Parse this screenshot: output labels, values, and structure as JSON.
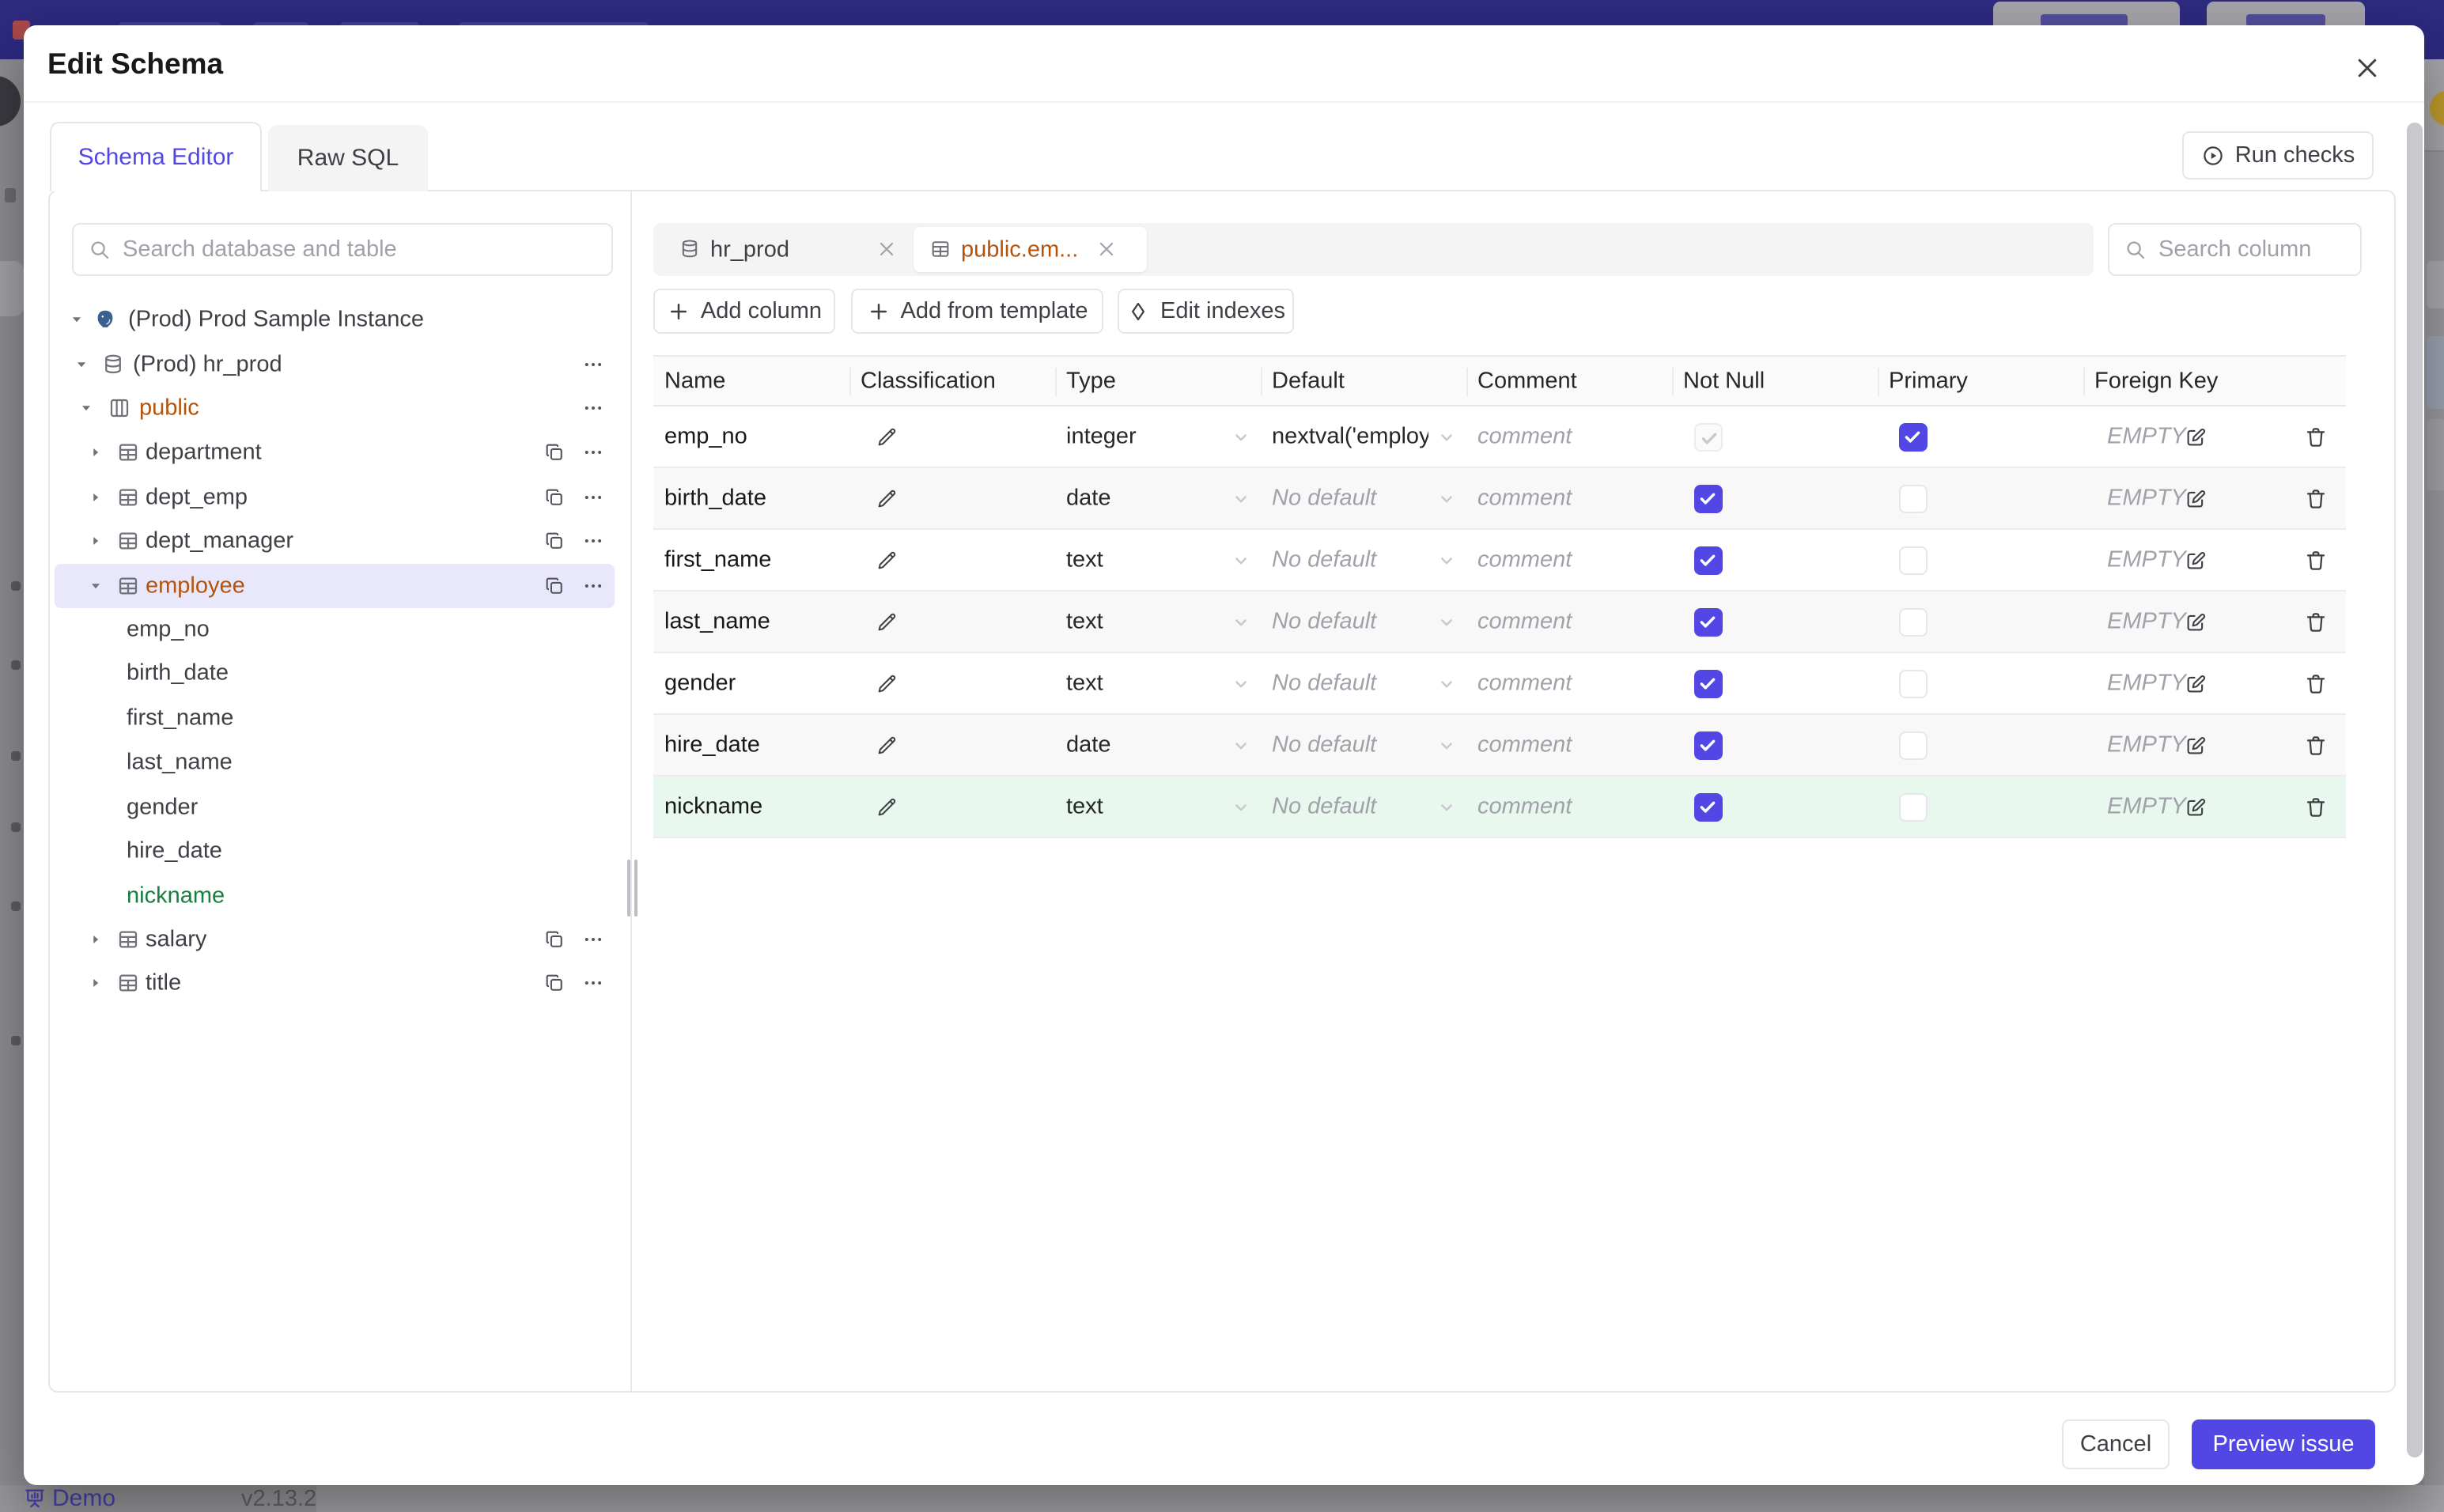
{
  "backdrop": {
    "demo_label": "Demo",
    "version_label": "v2.13.2"
  },
  "modal": {
    "title": "Edit Schema",
    "tabs": [
      {
        "label": "Schema Editor",
        "active": true
      },
      {
        "label": "Raw SQL",
        "active": false
      }
    ],
    "run_checks_label": "Run checks",
    "footer": {
      "cancel_label": "Cancel",
      "preview_label": "Preview issue"
    }
  },
  "sidebar": {
    "search_placeholder": "Search database and table",
    "tree": [
      {
        "level": 0,
        "icon": "postgres-icon",
        "caret": "down",
        "label": "(Prod) Prod Sample Instance",
        "color": null,
        "selected": false,
        "actions": []
      },
      {
        "level": 1,
        "icon": "database-icon",
        "caret": "down",
        "label": "(Prod) hr_prod",
        "color": null,
        "selected": false,
        "actions": [
          "more"
        ]
      },
      {
        "level": 2,
        "icon": "schema-icon",
        "caret": "down",
        "label": "public",
        "color": "amber",
        "selected": false,
        "actions": [
          "more"
        ]
      },
      {
        "level": 3,
        "icon": "table-icon",
        "caret": "right",
        "label": "department",
        "color": null,
        "selected": false,
        "actions": [
          "copy",
          "more"
        ]
      },
      {
        "level": 3,
        "icon": "table-icon",
        "caret": "right",
        "label": "dept_emp",
        "color": null,
        "selected": false,
        "actions": [
          "copy",
          "more"
        ]
      },
      {
        "level": 3,
        "icon": "table-icon",
        "caret": "right",
        "label": "dept_manager",
        "color": null,
        "selected": false,
        "actions": [
          "copy",
          "more"
        ]
      },
      {
        "level": 3,
        "icon": "table-icon",
        "caret": "down",
        "label": "employee",
        "color": "amber",
        "selected": true,
        "actions": [
          "copy",
          "more"
        ]
      },
      {
        "level": 4,
        "icon": null,
        "caret": null,
        "label": "emp_no",
        "color": null,
        "selected": false,
        "actions": []
      },
      {
        "level": 4,
        "icon": null,
        "caret": null,
        "label": "birth_date",
        "color": null,
        "selected": false,
        "actions": []
      },
      {
        "level": 4,
        "icon": null,
        "caret": null,
        "label": "first_name",
        "color": null,
        "selected": false,
        "actions": []
      },
      {
        "level": 4,
        "icon": null,
        "caret": null,
        "label": "last_name",
        "color": null,
        "selected": false,
        "actions": []
      },
      {
        "level": 4,
        "icon": null,
        "caret": null,
        "label": "gender",
        "color": null,
        "selected": false,
        "actions": []
      },
      {
        "level": 4,
        "icon": null,
        "caret": null,
        "label": "hire_date",
        "color": null,
        "selected": false,
        "actions": []
      },
      {
        "level": 4,
        "icon": null,
        "caret": null,
        "label": "nickname",
        "color": "green",
        "selected": false,
        "actions": []
      },
      {
        "level": 3,
        "icon": "table-icon",
        "caret": "right",
        "label": "salary",
        "color": null,
        "selected": false,
        "actions": [
          "copy",
          "more"
        ]
      },
      {
        "level": 3,
        "icon": "table-icon",
        "caret": "right",
        "label": "title",
        "color": null,
        "selected": false,
        "actions": [
          "copy",
          "more"
        ]
      }
    ]
  },
  "editor": {
    "chips": [
      {
        "icon": "database-icon",
        "label": "hr_prod",
        "active": false
      },
      {
        "icon": "table-icon",
        "label": "public.em...",
        "active": true
      }
    ],
    "column_search_placeholder": "Search column",
    "toolbar": [
      {
        "icon": "plus-icon",
        "label": "Add column"
      },
      {
        "icon": "plus-icon",
        "label": "Add from template"
      },
      {
        "icon": "diamond-icon",
        "label": "Edit indexes"
      }
    ],
    "table": {
      "headers": [
        "Name",
        "Classification",
        "Type",
        "Default",
        "Comment",
        "Not Null",
        "Primary",
        "Foreign Key"
      ],
      "no_default_label": "No default",
      "comment_placeholder": "comment",
      "fk_empty_label": "EMPTY",
      "rows": [
        {
          "name": "emp_no",
          "type": "integer",
          "default": "nextval('employ",
          "not_null": "disabled",
          "primary": true,
          "zebra": "plain"
        },
        {
          "name": "birth_date",
          "type": "date",
          "default": null,
          "not_null": "on",
          "primary": false,
          "zebra": "alt"
        },
        {
          "name": "first_name",
          "type": "text",
          "default": null,
          "not_null": "on",
          "primary": false,
          "zebra": "plain"
        },
        {
          "name": "last_name",
          "type": "text",
          "default": null,
          "not_null": "on",
          "primary": false,
          "zebra": "alt"
        },
        {
          "name": "gender",
          "type": "text",
          "default": null,
          "not_null": "on",
          "primary": false,
          "zebra": "plain"
        },
        {
          "name": "hire_date",
          "type": "date",
          "default": null,
          "not_null": "on",
          "primary": false,
          "zebra": "alt"
        },
        {
          "name": "nickname",
          "type": "text",
          "default": null,
          "not_null": "on",
          "primary": false,
          "zebra": "new"
        }
      ]
    }
  },
  "colors": {
    "accent_indigo": "#5247e5",
    "amber_text": "#b45309",
    "green_text": "#15803d",
    "selected_tree_row_bg": "#e8e7fb",
    "new_row_bg": "#e8f8ee",
    "alt_row_bg": "#f8f8f9",
    "dimmed_header_bar": "#2d2a80",
    "backdrop_gray": "#8e8e92",
    "checkbox_checked": "#5247e5"
  }
}
